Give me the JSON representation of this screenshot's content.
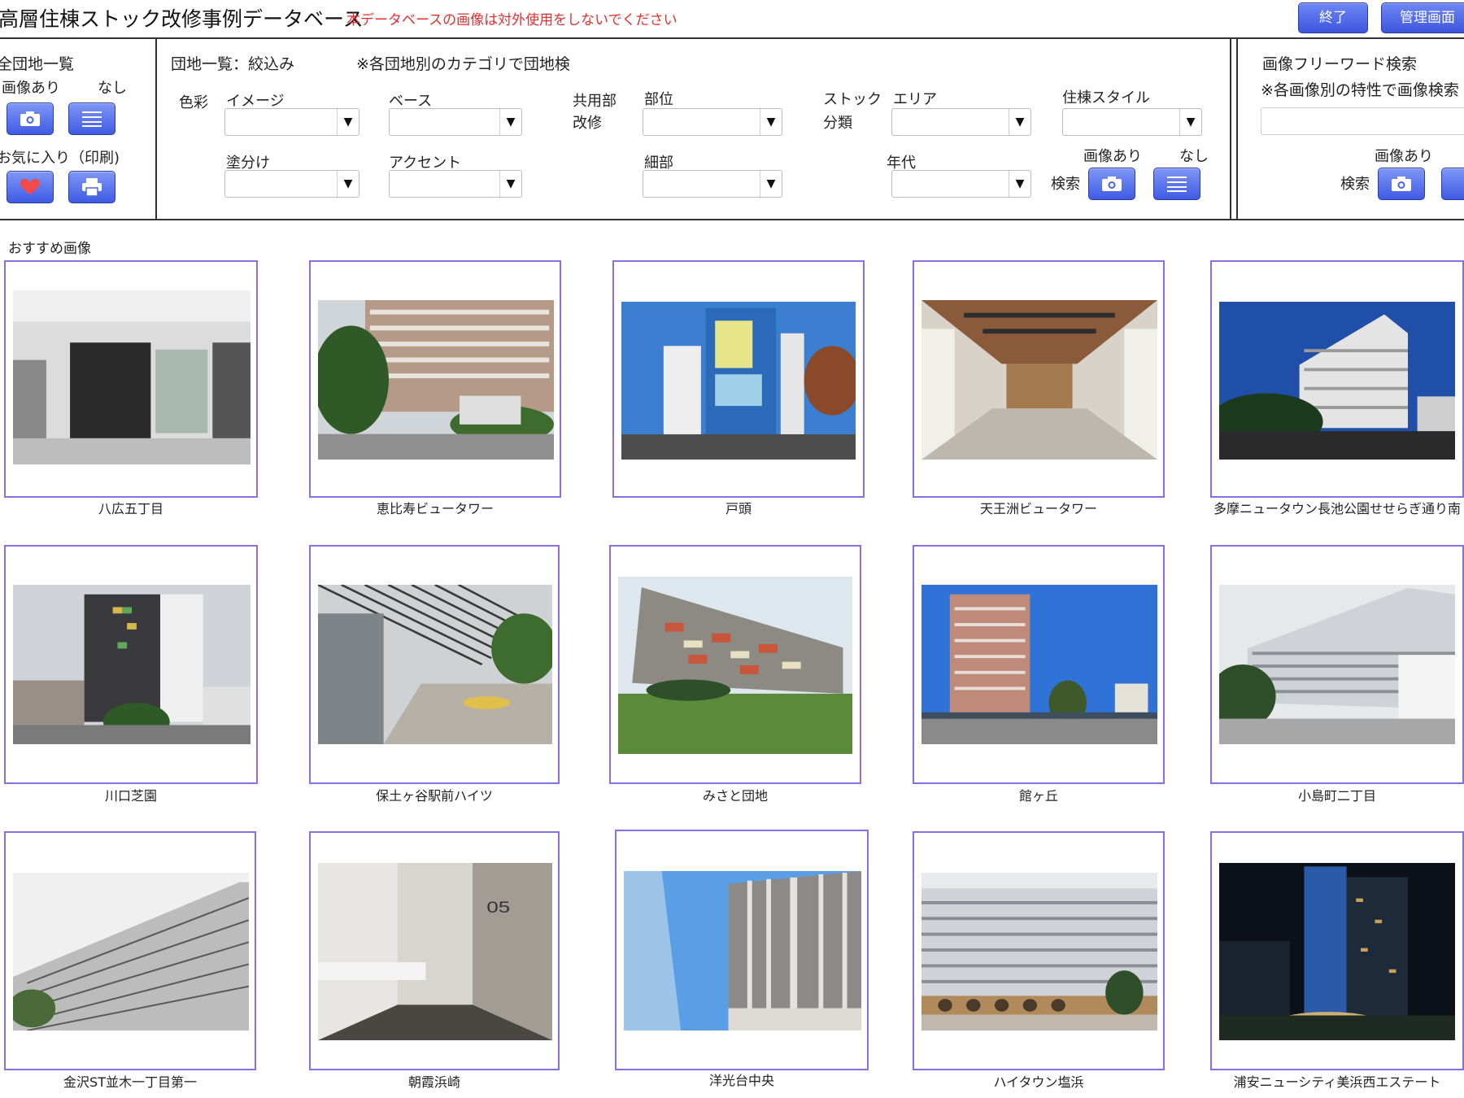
{
  "header": {
    "title": "高層住棟ストック改修事例データベース",
    "warning": "本データベースの画像は対外使用をしないでください",
    "exit_label": "終了",
    "admin_label": "管理画面"
  },
  "left_panel": {
    "title": "全団地一覧",
    "with_images": "画像あり",
    "without_images": "なし",
    "favorites": "お気に入り（印刷)"
  },
  "filter_panel": {
    "title": "団地一覧：絞込み",
    "note": "※各団地別のカテゴリで団地検",
    "color_group": "色彩",
    "image_label": "イメージ",
    "base_label": "ベース",
    "paint_label": "塗分け",
    "accent_label": "アクセント",
    "common_label_1": "共用部",
    "common_label_2": "改修",
    "part_label": "部位",
    "detail_label": "細部",
    "stock_label_1": "ストック",
    "stock_label_2": "分類",
    "area_label": "エリア",
    "era_label": "年代",
    "style_label": "住棟スタイル",
    "with_images": "画像あり",
    "without_images": "なし",
    "search_label": "検索"
  },
  "free_search": {
    "title": "画像フリーワード検索",
    "note": "※各画像別の特性で画像検索",
    "input_value": "",
    "with_images": "画像あり",
    "search_label": "検索"
  },
  "gallery": {
    "label": "おすすめ画像",
    "items": [
      {
        "name": "八広五丁目"
      },
      {
        "name": "恵比寿ビュータワー"
      },
      {
        "name": "戸頭"
      },
      {
        "name": "天王洲ビュータワー"
      },
      {
        "name": "多摩ニュータウン長池公園せせらぎ通り南"
      },
      {
        "name": "川口芝園"
      },
      {
        "name": "保土ヶ谷駅前ハイツ"
      },
      {
        "name": "みさと団地"
      },
      {
        "name": "館ヶ丘"
      },
      {
        "name": "小島町二丁目"
      },
      {
        "name": "金沢ST並木一丁目第一"
      },
      {
        "name": "朝霞浜崎"
      },
      {
        "name": "洋光台中央"
      },
      {
        "name": "ハイタウン塩浜"
      },
      {
        "name": "浦安ニューシティ美浜西エステート"
      }
    ]
  },
  "colors": {
    "accent_button": "#4a63e8",
    "card_border": "#8a6fe0",
    "warning_text": "#e03030"
  },
  "icons": {
    "camera": "camera-icon",
    "list": "list-icon",
    "heart": "heart-icon",
    "print": "printer-icon",
    "dropdown": "dropdown-arrow-icon"
  }
}
